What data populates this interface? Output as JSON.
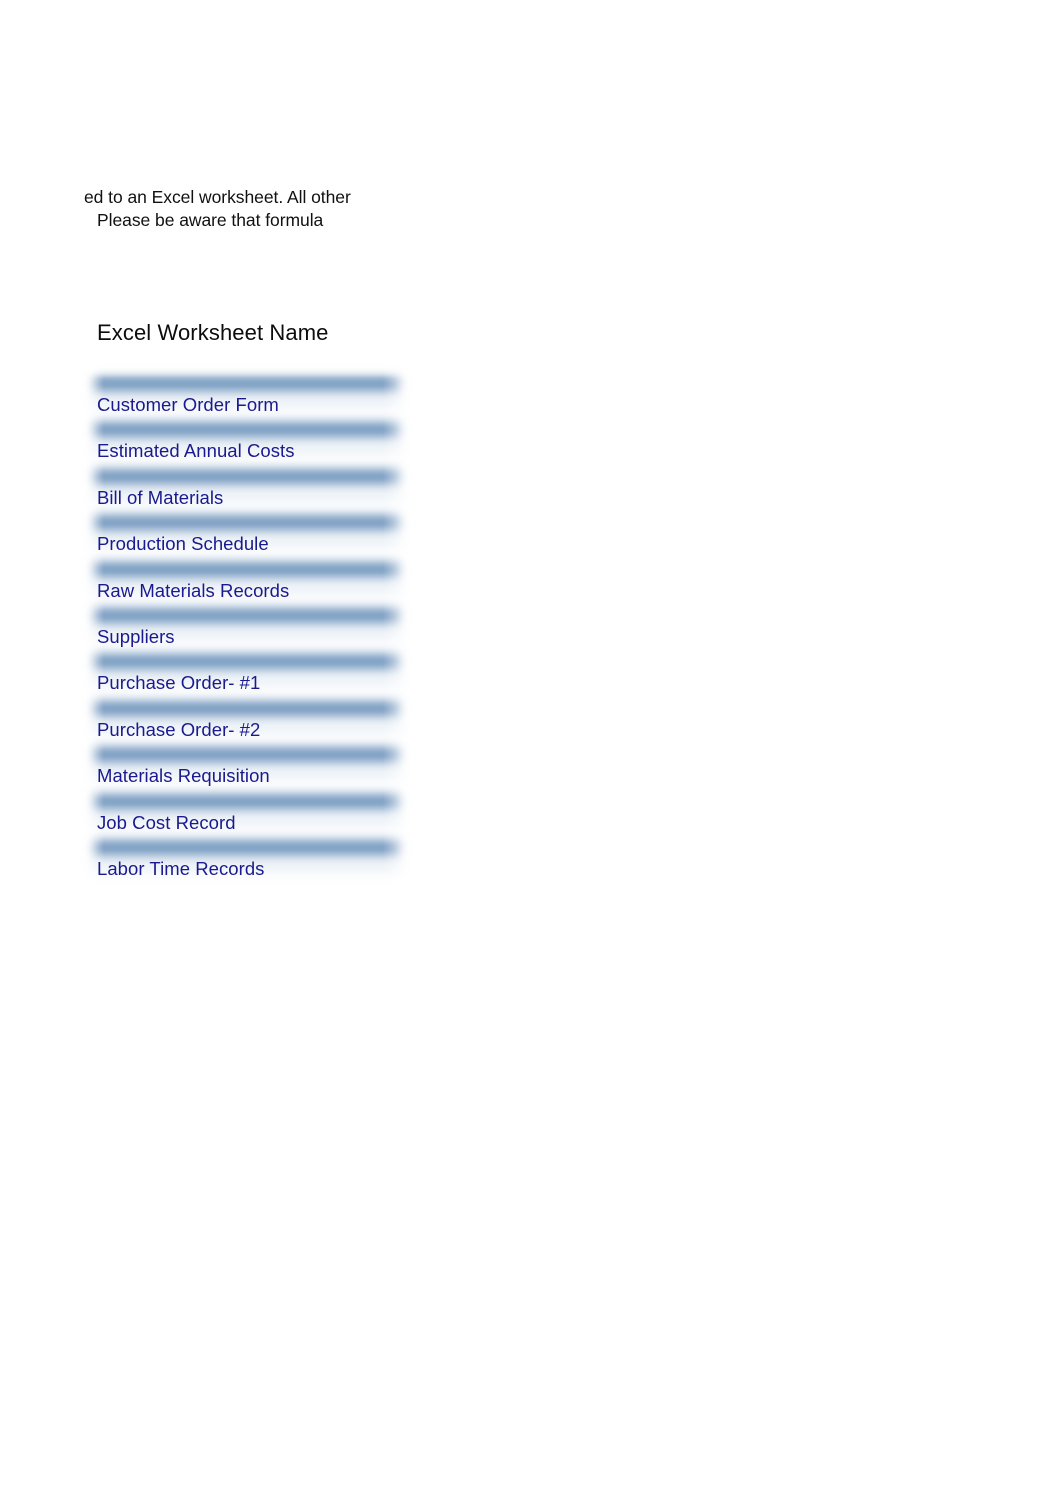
{
  "document": {
    "intro_text": {
      "line_1": "ed to an Excel worksheet. All other",
      "line_2": "Please be aware that formula"
    },
    "section_heading": "Excel Worksheet Name",
    "worksheet_list": {
      "items": [
        {
          "label": "Customer Order Form"
        },
        {
          "label": "Estimated Annual Costs"
        },
        {
          "label": "Bill of Materials"
        },
        {
          "label": "Production Schedule"
        },
        {
          "label": "Raw Materials Records"
        },
        {
          "label": "Suppliers"
        },
        {
          "label": "Purchase Order- #1"
        },
        {
          "label": "Purchase Order- #2"
        },
        {
          "label": "Materials Requisition"
        },
        {
          "label": "Job Cost Record"
        },
        {
          "label": "Labor Time Records"
        }
      ]
    }
  },
  "colors": {
    "page_background": "#ffffff",
    "bar_blue": "#7095bd",
    "bar_light": "#eef3f8",
    "link_text": "#1a1a8e",
    "body_text": "#111111",
    "heading_text": "#0d0d0d"
  }
}
